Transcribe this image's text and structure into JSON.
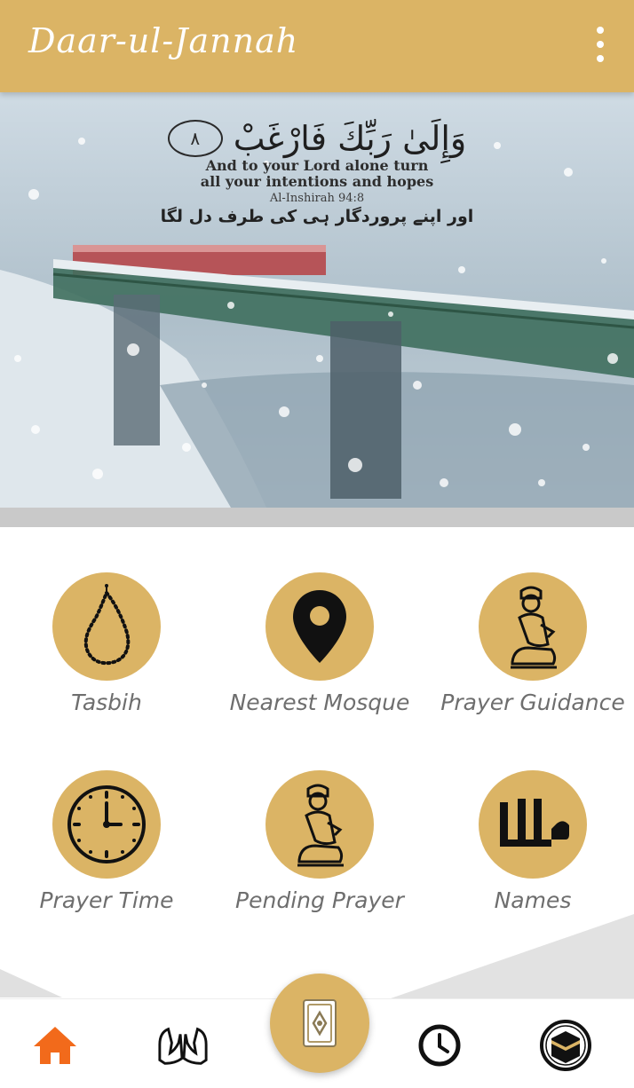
{
  "app_bar": {
    "title": "Daar-ul-Jannah",
    "menu_icon": "more-vert-icon",
    "background": "#dbb465"
  },
  "banner": {
    "arabic_verse": "وَإِلَىٰ رَبِّكَ فَارْغَبْ",
    "ayah_number": "٨",
    "english_line_1": "And to your Lord alone turn",
    "english_line_2": "all your intentions and hopes",
    "reference": "Al-Inshirah 94:8",
    "urdu_line": "اور اپنے پروردگار ہی کی طرف دل لگا"
  },
  "grid": [
    {
      "label": "Tasbih",
      "icon": "tasbih-beads-icon"
    },
    {
      "label": "Nearest Mosque",
      "icon": "location-pin-icon"
    },
    {
      "label": "Prayer Guidance",
      "icon": "praying-man-icon"
    },
    {
      "label": "Prayer Time",
      "icon": "clock-icon"
    },
    {
      "label": "Pending Prayer",
      "icon": "praying-man-icon"
    },
    {
      "label": "Names",
      "icon": "allah-calligraphy-icon"
    }
  ],
  "bottom_nav": {
    "items": [
      {
        "name": "home",
        "icon": "home-icon",
        "active": true
      },
      {
        "name": "dua",
        "icon": "praying-hands-icon"
      },
      {
        "name": "quran",
        "icon": "quran-book-icon"
      },
      {
        "name": "history",
        "icon": "clock-icon"
      },
      {
        "name": "kaaba",
        "icon": "kaaba-icon"
      }
    ],
    "active_color": "#f26a1b"
  },
  "colors": {
    "accent": "#dbb465",
    "label": "#6e6e6e"
  }
}
